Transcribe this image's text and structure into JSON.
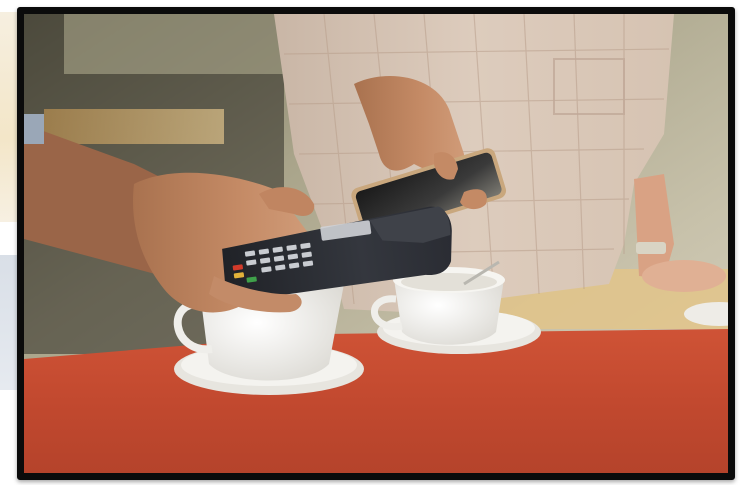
{
  "image": {
    "subject": "contactless-payment-photo",
    "palette": {
      "frame": "#0b0b0b",
      "table_top": "#c24a32",
      "cup": "#f2f1ee",
      "terminal": "#2b2d33",
      "phone": "#c9a77d",
      "shirt": "#d8c6b6",
      "background": "#b9b39d"
    }
  }
}
